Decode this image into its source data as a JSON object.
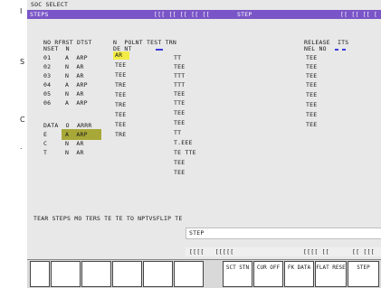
{
  "window_title": "SOC SELECT",
  "program_title": "STEPS",
  "status_bar": {
    "center": "[[[ [[ [[ [[ [[",
    "mode": "STEP",
    "right": "[[ [[ [[ ["
  },
  "left_margin_marks": [
    "I",
    "S",
    "C",
    "."
  ],
  "left_block": {
    "header": "NO RFRST DTST",
    "subheader": "NSET  N",
    "rows": [
      {
        "no": "01",
        "val": "A  ARP"
      },
      {
        "no": "02",
        "val": "N  AR"
      },
      {
        "no": "03",
        "val": "N  AR"
      },
      {
        "no": "04",
        "val": "A  ARP"
      },
      {
        "no": "05",
        "val": "N  AR"
      },
      {
        "no": "06",
        "val": "A  ARP"
      }
    ],
    "group_header": "DATA  O  ARRR",
    "group_rows": [
      {
        "no": "E",
        "val": "A  ARP"
      },
      {
        "no": "C",
        "val": "N  AR"
      },
      {
        "no": "T",
        "val": "N  AR"
      }
    ]
  },
  "mid_block": {
    "header": "N  POLNT TEST TRN",
    "subheader": "DE NT",
    "col1": [
      "AR",
      "TEE",
      "TEE",
      "TRE",
      "TEE",
      "TRE",
      "TEE",
      "TEE",
      "TRE"
    ],
    "col2": [
      "TT",
      "TEE",
      "TTT",
      "TTT",
      "TEE",
      "TTE",
      "TEE",
      "TEE",
      "TT",
      "T.EEE",
      "TE TTE",
      "TEE",
      "TEE"
    ]
  },
  "right_block": {
    "header": "RELEASE  ITS",
    "subheader": "NEL NO",
    "values": [
      "TEE",
      "TEE",
      "TEE",
      "TEE",
      "TEE",
      "TEE",
      "TEE",
      "TEE"
    ]
  },
  "message_line": "TEAR STEPS MO TERS TE TE TO NPTVSFLIP TE",
  "input_prompt": "STEP",
  "tabs": {
    "left": "[[[[   [[[[[",
    "mid": "[[[[ [[",
    "right": "[[ [[["
  },
  "softkeys": [
    "",
    "",
    "",
    "",
    "",
    "",
    "SCT STN",
    "CUR OFF",
    "FK DATA",
    "FLAT RESE",
    "STEP"
  ]
}
